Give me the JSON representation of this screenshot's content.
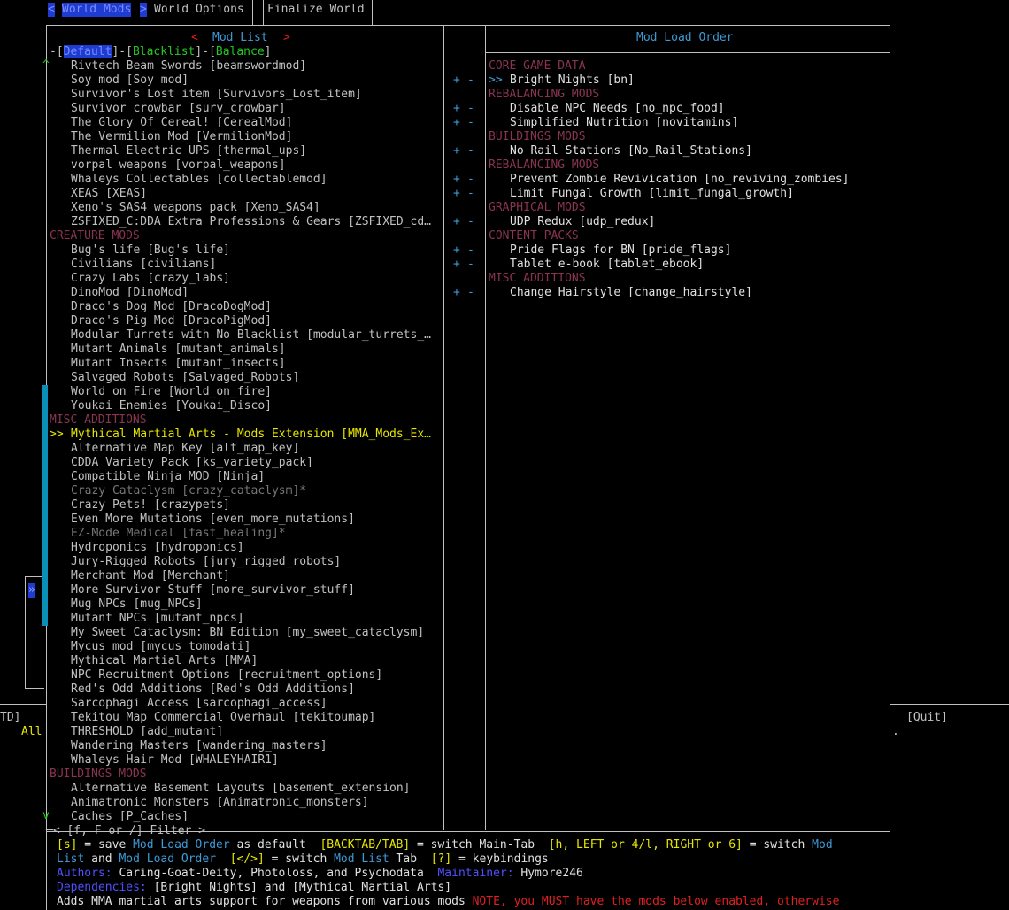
{
  "tabs": {
    "prev_arrow": "<",
    "world_mods": "World Mods",
    "next_arrow": ">",
    "world_options": "World Options",
    "finalize_world": "Finalize World"
  },
  "left_panel": {
    "title_left_arrow": "<",
    "title": "Mod List",
    "title_right_arrow": ">",
    "subtabs": [
      "Default",
      "Blacklist",
      "Balance"
    ],
    "scroll_up": "^",
    "scroll_down": "v",
    "rows": [
      {
        "text": "Rivtech Beam Swords [beamswordmod]",
        "kind": "item"
      },
      {
        "text": "Soy mod [Soy mod]",
        "kind": "item"
      },
      {
        "text": "Survivor's Lost item [Survivors_Lost_item]",
        "kind": "item"
      },
      {
        "text": "Survivor crowbar [surv_crowbar]",
        "kind": "item"
      },
      {
        "text": "The Glory Of Cereal! [CerealMod]",
        "kind": "item"
      },
      {
        "text": "The Vermilion Mod [VermilionMod]",
        "kind": "item"
      },
      {
        "text": "Thermal Electric UPS [thermal_ups]",
        "kind": "item"
      },
      {
        "text": "vorpal weapons [vorpal_weapons]",
        "kind": "item"
      },
      {
        "text": "Whaleys Collectables [collectablemod]",
        "kind": "item"
      },
      {
        "text": "XEAS [XEAS]",
        "kind": "item"
      },
      {
        "text": "Xeno's SAS4 weapons pack [Xeno_SAS4]",
        "kind": "item"
      },
      {
        "text": "ZSFIXED_C:DDA Extra Professions & Gears [ZSFIXED_cd…",
        "kind": "item"
      },
      {
        "text": "CREATURE MODS",
        "kind": "header"
      },
      {
        "text": "Bug's life [Bug's life]",
        "kind": "item"
      },
      {
        "text": "Civilians [civilians]",
        "kind": "item"
      },
      {
        "text": "Crazy Labs [crazy_labs]",
        "kind": "item"
      },
      {
        "text": "DinoMod [DinoMod]",
        "kind": "item"
      },
      {
        "text": "Draco's Dog Mod [DracoDogMod]",
        "kind": "item"
      },
      {
        "text": "Draco's Pig Mod [DracoPigMod]",
        "kind": "item"
      },
      {
        "text": "Modular Turrets with No Blacklist [modular_turrets_…",
        "kind": "item"
      },
      {
        "text": "Mutant Animals [mutant_animals]",
        "kind": "item"
      },
      {
        "text": "Mutant Insects [mutant_insects]",
        "kind": "item"
      },
      {
        "text": "Salvaged Robots [Salvaged_Robots]",
        "kind": "item"
      },
      {
        "text": "World on Fire [World_on_fire]",
        "kind": "item"
      },
      {
        "text": "Youkai Enemies [Youkai_Disco]",
        "kind": "item"
      },
      {
        "text": "MISC ADDITIONS",
        "kind": "header"
      },
      {
        "text": "Mythical Martial Arts - Mods Extension [MMA_Mods_Ex…",
        "kind": "selected",
        "marker": ">>"
      },
      {
        "text": "Alternative Map Key [alt_map_key]",
        "kind": "item"
      },
      {
        "text": "CDDA Variety Pack [ks_variety_pack]",
        "kind": "item"
      },
      {
        "text": "Compatible Ninja MOD [Ninja]",
        "kind": "item"
      },
      {
        "text": "Crazy Cataclysm [crazy_cataclysm]*",
        "kind": "disabled"
      },
      {
        "text": "Crazy Pets! [crazypets]",
        "kind": "item"
      },
      {
        "text": "Even More Mutations [even_more_mutations]",
        "kind": "item"
      },
      {
        "text": "EZ-Mode Medical [fast_healing]*",
        "kind": "disabled"
      },
      {
        "text": "Hydroponics [hydroponics]",
        "kind": "item"
      },
      {
        "text": "Jury-Rigged Robots [jury_rigged_robots]",
        "kind": "item"
      },
      {
        "text": "Merchant Mod [Merchant]",
        "kind": "item"
      },
      {
        "text": "More Survivor Stuff [more_survivor_stuff]",
        "kind": "item"
      },
      {
        "text": "Mug NPCs [mug_NPCs]",
        "kind": "item"
      },
      {
        "text": "Mutant NPCs [mutant_npcs]",
        "kind": "item"
      },
      {
        "text": "My Sweet Cataclysm: BN Edition [my_sweet_cataclysm]",
        "kind": "item"
      },
      {
        "text": "Mycus mod [mycus_tomodati]",
        "kind": "item"
      },
      {
        "text": "Mythical Martial Arts [MMA]",
        "kind": "item"
      },
      {
        "text": "NPC Recruitment Options [recruitment_options]",
        "kind": "item"
      },
      {
        "text": "Red's Odd Additions [Red's Odd Additions]",
        "kind": "item"
      },
      {
        "text": "Sarcophagi Access [sarcophagi_access]",
        "kind": "item"
      },
      {
        "text": "Tekitou Map Commercial Overhaul [tekitoumap]",
        "kind": "item"
      },
      {
        "text": "THRESHOLD [add_mutant]",
        "kind": "item"
      },
      {
        "text": "Wandering Masters [wandering_masters]",
        "kind": "item"
      },
      {
        "text": "Whaleys Hair Mod [WHALEYHAIR1]",
        "kind": "item"
      },
      {
        "text": "BUILDINGS MODS",
        "kind": "header"
      },
      {
        "text": "Alternative Basement Layouts [basement_extension]",
        "kind": "item"
      },
      {
        "text": "Animatronic Monsters [Animatronic_monsters]",
        "kind": "item"
      },
      {
        "text": "Caches [P_Caches]",
        "kind": "item"
      }
    ]
  },
  "right_panel": {
    "title": "Mod Load Order",
    "plus": "+",
    "minus": "-",
    "rows": [
      {
        "text": "CORE GAME DATA",
        "kind": "header"
      },
      {
        "text": "Bright Nights [bn]",
        "kind": "item",
        "marker": ">>",
        "controls": true
      },
      {
        "text": "REBALANCING MODS",
        "kind": "header"
      },
      {
        "text": "Disable NPC Needs [no_npc_food]",
        "kind": "item",
        "controls": true
      },
      {
        "text": "Simplified Nutrition [novitamins]",
        "kind": "item",
        "controls": true
      },
      {
        "text": "BUILDINGS MODS",
        "kind": "header"
      },
      {
        "text": "No Rail Stations [No_Rail_Stations]",
        "kind": "item",
        "controls": true
      },
      {
        "text": "REBALANCING MODS",
        "kind": "header"
      },
      {
        "text": "Prevent Zombie Revivication [no_reviving_zombies]",
        "kind": "item",
        "controls": true
      },
      {
        "text": "Limit Fungal Growth [limit_fungal_growth]",
        "kind": "item",
        "controls": true
      },
      {
        "text": "GRAPHICAL MODS",
        "kind": "header"
      },
      {
        "text": "UDP Redux [udp_redux]",
        "kind": "item",
        "controls": true
      },
      {
        "text": "CONTENT PACKS",
        "kind": "header"
      },
      {
        "text": "Pride Flags for BN [pride_flags]",
        "kind": "item",
        "controls": true
      },
      {
        "text": "Tablet e-book [tablet_ebook]",
        "kind": "item",
        "controls": true
      },
      {
        "text": "MISC ADDITIONS",
        "kind": "header"
      },
      {
        "text": "Change Hairstyle [change_hairstyle]",
        "kind": "item",
        "controls": true
      }
    ]
  },
  "background": {
    "left_fragment": "TD]",
    "all_fragment": "All",
    "quit_label": "[Quit]",
    "dot": ".",
    "side_arrow": "»"
  },
  "filter": {
    "left": "<",
    "text": "[f, F or /] Filter",
    "right": ">"
  },
  "help": {
    "line1": [
      {
        "t": "[s]",
        "c": "yellow"
      },
      {
        "t": " = save ",
        "c": "white"
      },
      {
        "t": "Mod Load Order",
        "c": "blue"
      },
      {
        "t": " as default  ",
        "c": "white"
      },
      {
        "t": "[BACKTAB/TAB]",
        "c": "yellow"
      },
      {
        "t": " = switch Main-Tab  ",
        "c": "white"
      },
      {
        "t": "[h, LEFT or 4/l, RIGHT or 6]",
        "c": "yellow"
      },
      {
        "t": " = switch ",
        "c": "white"
      },
      {
        "t": "Mod",
        "c": "blue"
      }
    ],
    "line2": [
      {
        "t": "List",
        "c": "blue"
      },
      {
        "t": " and ",
        "c": "white"
      },
      {
        "t": "Mod Load Order",
        "c": "blue"
      },
      {
        "t": "  ",
        "c": "white"
      },
      {
        "t": "[</>]",
        "c": "yellow"
      },
      {
        "t": " = switch ",
        "c": "white"
      },
      {
        "t": "Mod List",
        "c": "blue"
      },
      {
        "t": " Tab  ",
        "c": "white"
      },
      {
        "t": "[?]",
        "c": "yellow"
      },
      {
        "t": " = keybindings",
        "c": "white"
      }
    ],
    "line3": [
      {
        "t": "Authors:",
        "c": "brightblue"
      },
      {
        "t": " Caring-Goat-Deity, Photoloss, and Psychodata  ",
        "c": "white"
      },
      {
        "t": "Maintainer:",
        "c": "brightblue"
      },
      {
        "t": " Hymore246",
        "c": "white"
      }
    ],
    "line4": [
      {
        "t": "Dependencies:",
        "c": "brightblue"
      },
      {
        "t": " [Bright Nights] and [Mythical Martial Arts]",
        "c": "white"
      }
    ],
    "line5": [
      {
        "t": "Adds MMA martial arts support for weapons from various mods ",
        "c": "white"
      },
      {
        "t": "NOTE, you MUST have the mods below enabled, otherwise",
        "c": "red"
      }
    ]
  }
}
